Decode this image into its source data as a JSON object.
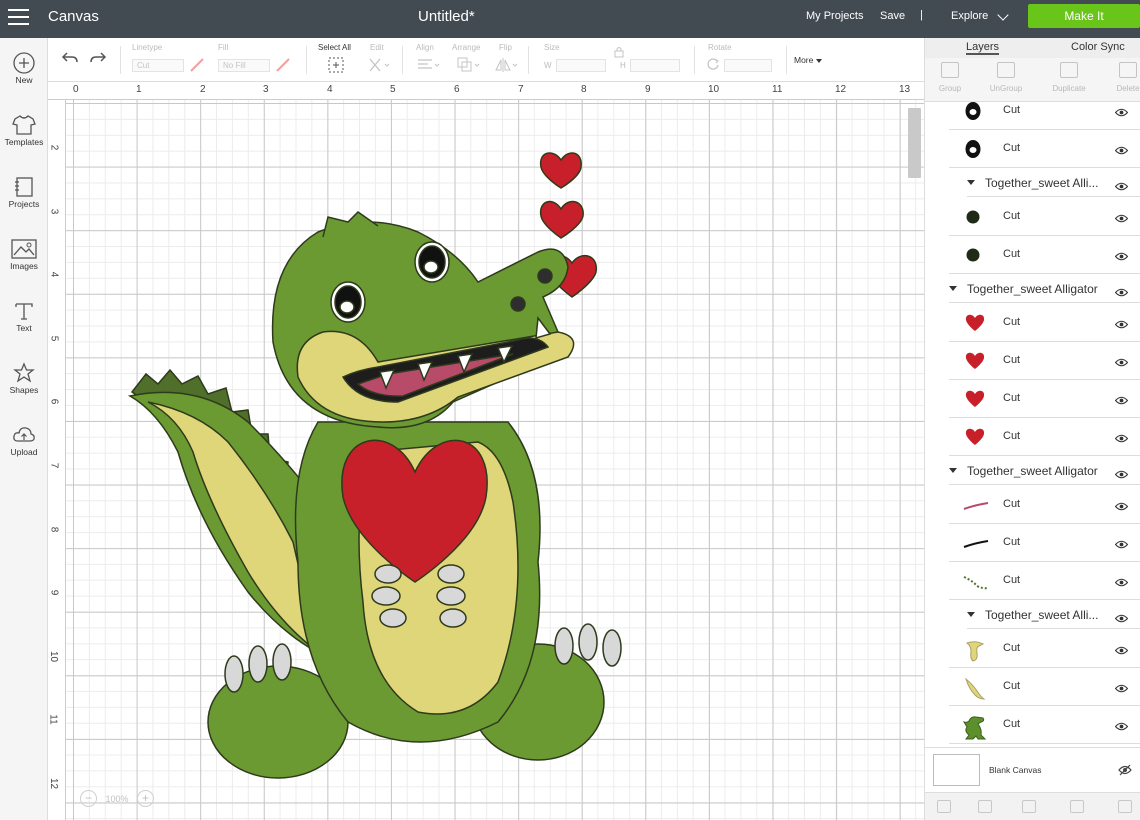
{
  "topbar": {
    "app_title": "Canvas",
    "doc_title": "Untitled*",
    "my_projects": "My Projects",
    "save": "Save",
    "separator": "|",
    "explore": "Explore",
    "make_it": "Make It",
    "make_it_color": "#6ac51a",
    "bar_color": "#434b52"
  },
  "left_nav": {
    "new": "New",
    "templates": "Templates",
    "projects": "Projects",
    "images": "Images",
    "text": "Text",
    "shapes": "Shapes",
    "upload": "Upload"
  },
  "toolbar": {
    "linetype_label": "Linetype",
    "linetype_value": "Cut",
    "fill_label": "Fill",
    "fill_value": "No Fill",
    "select_all": "Select All",
    "edit": "Edit",
    "align": "Align",
    "arrange": "Arrange",
    "flip": "Flip",
    "size": "Size",
    "w": "W",
    "h": "H",
    "rotate": "Rotate",
    "more": "More"
  },
  "canvas": {
    "ruler_top": [
      "0",
      "1",
      "2",
      "3",
      "4",
      "5",
      "6",
      "7",
      "8",
      "9",
      "10",
      "11",
      "12",
      "13"
    ],
    "ruler_left": [
      "2",
      "3",
      "4",
      "5",
      "6",
      "7",
      "8",
      "9",
      "10",
      "11",
      "12"
    ],
    "zoom_minus": "−",
    "zoom_value": "100%",
    "zoom_plus": "+",
    "artwork": "sweet alligator holding heart"
  },
  "panel": {
    "tab_layers": "Layers",
    "tab_color_sync": "Color Sync",
    "group": "Group",
    "ungroup": "UnGroup",
    "duplicate": "Duplicate",
    "delete": "Delete",
    "layers": [
      {
        "type": "layer",
        "label": "Cut",
        "thumb": "eye-black"
      },
      {
        "type": "layer",
        "label": "Cut",
        "thumb": "eye-black"
      },
      {
        "type": "group",
        "label": "Together_sweet Alli...",
        "indent": true
      },
      {
        "type": "layer",
        "label": "Cut",
        "thumb": "dot-dark"
      },
      {
        "type": "layer",
        "label": "Cut",
        "thumb": "dot-dark"
      },
      {
        "type": "group",
        "label": "Together_sweet Alligator",
        "indent": false
      },
      {
        "type": "layer",
        "label": "Cut",
        "thumb": "heart-red"
      },
      {
        "type": "layer",
        "label": "Cut",
        "thumb": "heart-red"
      },
      {
        "type": "layer",
        "label": "Cut",
        "thumb": "heart-red"
      },
      {
        "type": "layer",
        "label": "Cut",
        "thumb": "heart-red"
      },
      {
        "type": "group",
        "label": "Together_sweet Alligator",
        "indent": false
      },
      {
        "type": "layer",
        "label": "Cut",
        "thumb": "line-red"
      },
      {
        "type": "layer",
        "label": "Cut",
        "thumb": "line-black"
      },
      {
        "type": "layer",
        "label": "Cut",
        "thumb": "line-dots"
      },
      {
        "type": "group",
        "label": "Together_sweet Alli...",
        "indent": true
      },
      {
        "type": "layer",
        "label": "Cut",
        "thumb": "yellow-belly"
      },
      {
        "type": "layer",
        "label": "Cut",
        "thumb": "yellow-tail"
      },
      {
        "type": "layer",
        "label": "Cut",
        "thumb": "green-gator"
      }
    ],
    "blank_canvas": "Blank Canvas"
  }
}
